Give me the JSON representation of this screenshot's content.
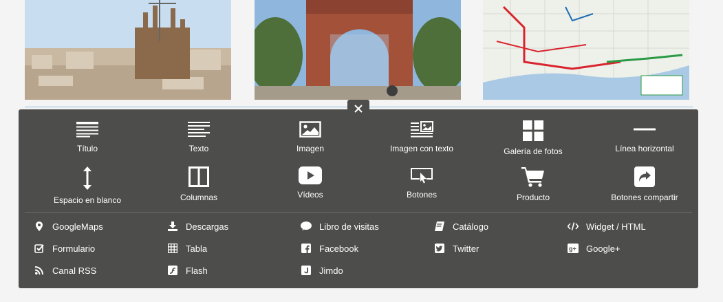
{
  "tiles": [
    {
      "label": "Título",
      "icon": "title-icon"
    },
    {
      "label": "Texto",
      "icon": "text-icon"
    },
    {
      "label": "Imagen",
      "icon": "image-icon"
    },
    {
      "label": "Imagen con texto",
      "icon": "image-text-icon"
    },
    {
      "label": "Galería de fotos",
      "icon": "gallery-icon"
    },
    {
      "label": "Línea horizontal",
      "icon": "horizontal-line-icon"
    },
    {
      "label": "Espacio en blanco",
      "icon": "vertical-arrows-icon"
    },
    {
      "label": "Columnas",
      "icon": "columns-icon"
    },
    {
      "label": "Vídeos",
      "icon": "video-play-icon"
    },
    {
      "label": "Botones",
      "icon": "button-cursor-icon"
    },
    {
      "label": "Producto",
      "icon": "shopping-cart-icon"
    },
    {
      "label": "Botones compartir",
      "icon": "share-arrow-icon"
    }
  ],
  "links": [
    {
      "label": "GoogleMaps",
      "icon": "map-pin-icon"
    },
    {
      "label": "Descargas",
      "icon": "download-icon"
    },
    {
      "label": "Libro de visitas",
      "icon": "comment-icon"
    },
    {
      "label": "Catálogo",
      "icon": "book-icon"
    },
    {
      "label": "Widget / HTML",
      "icon": "code-icon"
    },
    {
      "label": "Formulario",
      "icon": "checkbox-icon"
    },
    {
      "label": "Tabla",
      "icon": "table-icon"
    },
    {
      "label": "Facebook",
      "icon": "facebook-icon"
    },
    {
      "label": "Twitter",
      "icon": "twitter-icon"
    },
    {
      "label": "Google+",
      "icon": "google-plus-icon"
    },
    {
      "label": "Canal RSS",
      "icon": "rss-icon"
    },
    {
      "label": "Flash",
      "icon": "flash-icon"
    },
    {
      "label": "Jimdo",
      "icon": "jimdo-icon"
    }
  ],
  "colors": {
    "panel": "#4d4d4b",
    "page_bg": "#f4f4f4",
    "divider": "#8fc0e0",
    "icon": "#ffffff"
  }
}
